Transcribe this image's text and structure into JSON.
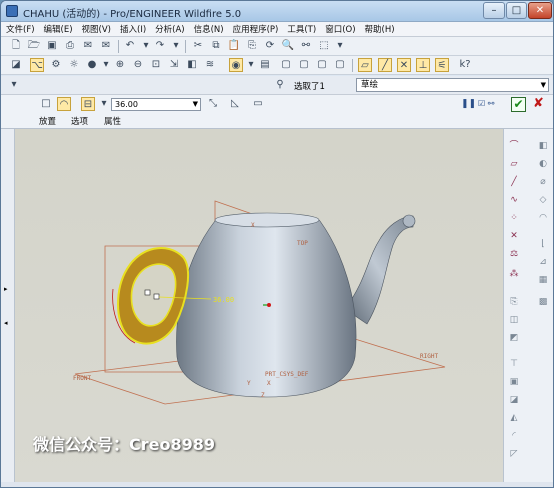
{
  "window": {
    "title": "CHAHU (活动的) - Pro/ENGINEER Wildfire 5.0"
  },
  "menu": [
    "文件(F)",
    "编辑(E)",
    "视图(V)",
    "插入(I)",
    "分析(A)",
    "信息(N)",
    "应用程序(P)",
    "工具(T)",
    "窗口(O)",
    "帮助(H)"
  ],
  "selection": {
    "status": "选取了1",
    "filter": "草绘"
  },
  "dashboard": {
    "depth_value": "36.00",
    "tabs": [
      "放置",
      "选项",
      "属性"
    ]
  },
  "viewport": {
    "datum_labels": {
      "front": "FRONT",
      "top": "TOP",
      "right": "RIGHT",
      "csys": "PRT_CSYS_DEF",
      "x": "X",
      "y": "Y",
      "z": "Z"
    },
    "dimension": "36.00",
    "watermark": "微信公众号：Creo8989"
  },
  "colors": {
    "accent": "#1a8a1a",
    "handle_yellow": "#e8e020",
    "datum": "#c07050"
  }
}
